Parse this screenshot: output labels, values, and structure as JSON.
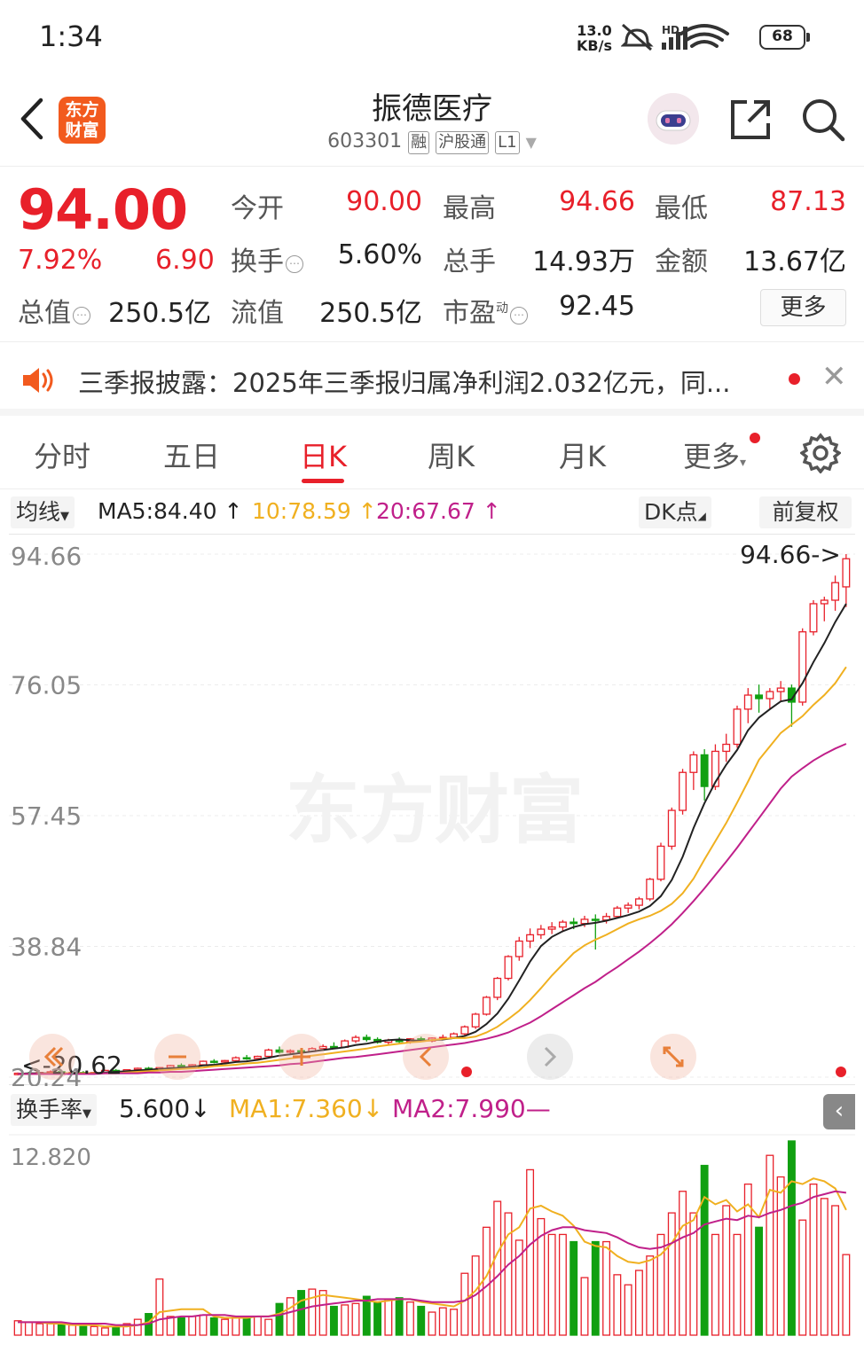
{
  "status_bar": {
    "time": "1:34",
    "net_speed_value": "13.0",
    "net_speed_unit": "KB/s",
    "network": "HD",
    "battery": "68",
    "icons": [
      "mute-icon",
      "signal-icon",
      "wifi-icon",
      "battery-icon"
    ]
  },
  "header": {
    "logo_line1": "东方",
    "logo_line2": "财富",
    "title": "振德医疗",
    "code": "603301",
    "tags": [
      "融",
      "沪股通",
      "L1"
    ]
  },
  "quote": {
    "price": "94.00",
    "change_pct": "7.92%",
    "change": "6.90",
    "fields": {
      "open_label": "今开",
      "open": "90.00",
      "high_label": "最高",
      "high": "94.66",
      "low_label": "最低",
      "low": "87.13",
      "turnover_label": "换手",
      "turnover": "5.60%",
      "volume_label": "总手",
      "volume": "14.93万",
      "amount_label": "金额",
      "amount": "13.67亿",
      "mktcap_label": "总值",
      "mktcap": "250.5亿",
      "float_label": "流值",
      "float_cap": "250.5亿",
      "pe_label": "市盈",
      "pe_sup": "动",
      "pe": "92.45"
    },
    "more_label": "更多"
  },
  "news": {
    "text": "三季报披露：2025年三季报归属净利润2.032亿元，同..."
  },
  "tabs": [
    {
      "label": "分时"
    },
    {
      "label": "五日"
    },
    {
      "label": "日K",
      "active": true
    },
    {
      "label": "周K"
    },
    {
      "label": "月K"
    },
    {
      "label": "更多"
    }
  ],
  "ma_bar": {
    "selector": "均线",
    "ma5": "MA5:84.40",
    "ma10": "10:78.59",
    "ma20": "20:67.67",
    "dk_label": "DK点",
    "adjust_label": "前复权"
  },
  "kline": {
    "y_labels": [
      "94.66",
      "76.05",
      "57.45",
      "38.84",
      "20.24"
    ],
    "high_note": "94.66->",
    "low_note": "<-20.62",
    "watermark": "东方财富",
    "colors": {
      "up": "#e8202a",
      "down": "#11a011",
      "ma5": "#222222",
      "ma10": "#f0b020",
      "ma20": "#c0208a"
    }
  },
  "volume": {
    "selector": "换手率",
    "value": "5.600",
    "ma1": "MA1:7.360",
    "ma2": "MA2:7.990—",
    "y_label": "12.820"
  },
  "chart_data": {
    "type": "candlestick",
    "ylim": [
      20.24,
      94.66
    ],
    "candles": [
      [
        20.6,
        20.9,
        20.5,
        20.8
      ],
      [
        20.8,
        21.0,
        20.6,
        20.7
      ],
      [
        20.7,
        20.9,
        20.5,
        20.9
      ],
      [
        20.9,
        21.2,
        20.8,
        21.0
      ],
      [
        21.0,
        21.1,
        20.7,
        20.8
      ],
      [
        20.8,
        21.0,
        20.6,
        20.9
      ],
      [
        20.9,
        21.1,
        20.7,
        20.8
      ],
      [
        20.8,
        21.0,
        20.62,
        20.9
      ],
      [
        20.9,
        21.3,
        20.8,
        21.2
      ],
      [
        21.2,
        21.4,
        21.0,
        21.1
      ],
      [
        21.1,
        21.3,
        20.9,
        21.3
      ],
      [
        21.3,
        21.6,
        21.2,
        21.5
      ],
      [
        21.5,
        21.7,
        21.3,
        21.4
      ],
      [
        21.4,
        21.6,
        21.2,
        21.6
      ],
      [
        21.6,
        22.0,
        21.5,
        21.9
      ],
      [
        21.9,
        22.2,
        21.7,
        21.8
      ],
      [
        21.8,
        22.1,
        21.6,
        22.0
      ],
      [
        22.0,
        22.6,
        21.9,
        22.5
      ],
      [
        22.5,
        22.8,
        22.2,
        22.4
      ],
      [
        22.4,
        22.7,
        22.1,
        22.6
      ],
      [
        22.6,
        23.2,
        22.5,
        23.0
      ],
      [
        23.0,
        23.4,
        22.7,
        22.9
      ],
      [
        22.9,
        23.3,
        22.6,
        23.2
      ],
      [
        23.2,
        24.3,
        23.1,
        24.1
      ],
      [
        24.1,
        24.6,
        23.6,
        23.8
      ],
      [
        23.8,
        24.2,
        23.4,
        24.0
      ],
      [
        24.0,
        24.4,
        23.7,
        23.9
      ],
      [
        23.9,
        24.5,
        23.8,
        24.3
      ],
      [
        24.3,
        24.9,
        24.1,
        24.6
      ],
      [
        24.6,
        25.2,
        24.3,
        24.5
      ],
      [
        24.5,
        25.6,
        24.4,
        25.4
      ],
      [
        25.4,
        26.2,
        25.1,
        25.9
      ],
      [
        25.9,
        26.3,
        25.3,
        25.6
      ],
      [
        25.6,
        25.9,
        25.0,
        25.2
      ],
      [
        25.2,
        25.7,
        24.9,
        25.5
      ],
      [
        25.5,
        25.9,
        25.1,
        25.3
      ],
      [
        25.3,
        25.8,
        25.0,
        25.7
      ],
      [
        25.7,
        26.0,
        25.3,
        25.4
      ],
      [
        25.4,
        25.9,
        25.2,
        25.8
      ],
      [
        25.8,
        26.3,
        25.5,
        25.9
      ],
      [
        25.9,
        26.6,
        25.7,
        26.4
      ],
      [
        26.4,
        27.6,
        26.2,
        27.4
      ],
      [
        27.4,
        29.4,
        27.1,
        29.2
      ],
      [
        29.2,
        31.8,
        29.0,
        31.6
      ],
      [
        31.6,
        34.5,
        31.2,
        34.3
      ],
      [
        34.3,
        37.6,
        34.0,
        37.4
      ],
      [
        37.4,
        40.2,
        36.8,
        39.6
      ],
      [
        39.6,
        41.4,
        38.6,
        40.5
      ],
      [
        40.5,
        41.9,
        39.9,
        41.3
      ],
      [
        41.3,
        42.3,
        40.6,
        41.6
      ],
      [
        41.6,
        42.6,
        40.9,
        42.3
      ],
      [
        42.3,
        42.9,
        41.3,
        42.1
      ],
      [
        42.1,
        43.2,
        41.6,
        42.7
      ],
      [
        42.7,
        43.4,
        38.4,
        42.6
      ],
      [
        42.6,
        43.6,
        42.1,
        43.1
      ],
      [
        43.1,
        44.6,
        42.9,
        44.3
      ],
      [
        44.3,
        45.1,
        43.6,
        44.7
      ],
      [
        44.7,
        45.9,
        44.1,
        45.6
      ],
      [
        45.6,
        48.6,
        45.3,
        48.4
      ],
      [
        48.4,
        53.6,
        48.1,
        53.1
      ],
      [
        53.1,
        58.6,
        52.6,
        58.2
      ],
      [
        58.2,
        64.1,
        57.6,
        63.6
      ],
      [
        63.6,
        66.6,
        61.1,
        66.1
      ],
      [
        66.1,
        66.9,
        59.6,
        61.6
      ],
      [
        61.6,
        67.6,
        61.1,
        66.6
      ],
      [
        66.6,
        69.1,
        65.1,
        67.6
      ],
      [
        67.6,
        73.1,
        67.1,
        72.6
      ],
      [
        72.6,
        75.6,
        70.6,
        74.6
      ],
      [
        74.6,
        76.1,
        72.1,
        74.1
      ],
      [
        74.1,
        75.6,
        72.6,
        75.1
      ],
      [
        75.1,
        76.6,
        73.6,
        75.6
      ],
      [
        75.6,
        76.1,
        70.1,
        73.6
      ],
      [
        73.6,
        84.1,
        73.1,
        83.6
      ],
      [
        83.6,
        88.1,
        83.1,
        87.6
      ],
      [
        87.6,
        88.6,
        85.1,
        88.1
      ],
      [
        88.1,
        91.6,
        86.6,
        90.6
      ],
      [
        90.0,
        94.66,
        87.13,
        94.0
      ]
    ],
    "ma5": [
      20.7,
      20.8,
      20.8,
      20.8,
      20.8,
      20.8,
      20.8,
      20.8,
      20.9,
      21.0,
      21.1,
      21.2,
      21.3,
      21.4,
      21.5,
      21.6,
      21.7,
      21.9,
      22.0,
      22.2,
      22.4,
      22.5,
      22.7,
      23.0,
      23.3,
      23.5,
      23.7,
      23.9,
      24.1,
      24.3,
      24.5,
      24.8,
      25.0,
      25.3,
      25.5,
      25.6,
      25.5,
      25.4,
      25.5,
      25.6,
      25.8,
      26.1,
      26.7,
      27.8,
      29.3,
      31.4,
      34.0,
      36.7,
      38.9,
      40.2,
      41.0,
      41.6,
      42.0,
      42.2,
      42.5,
      42.9,
      43.3,
      43.8,
      44.6,
      46.0,
      48.3,
      51.6,
      55.7,
      59.2,
      62.2,
      64.7,
      66.8,
      69.6,
      71.4,
      72.6,
      73.7,
      74.0,
      76.3,
      79.3,
      82.0,
      85.0,
      87.6
    ],
    "ma10": [
      20.7,
      20.7,
      20.7,
      20.8,
      20.8,
      20.8,
      20.8,
      20.8,
      20.8,
      20.8,
      20.9,
      21.0,
      21.1,
      21.2,
      21.3,
      21.4,
      21.5,
      21.6,
      21.8,
      21.9,
      22.0,
      22.2,
      22.3,
      22.5,
      22.7,
      22.9,
      23.1,
      23.3,
      23.5,
      23.7,
      23.9,
      24.1,
      24.3,
      24.6,
      24.8,
      25.0,
      25.2,
      25.3,
      25.5,
      25.7,
      25.8,
      25.8,
      26.0,
      26.6,
      27.4,
      28.5,
      29.7,
      31.2,
      32.9,
      34.7,
      36.3,
      37.9,
      39.0,
      39.8,
      40.5,
      41.3,
      42.1,
      42.7,
      43.2,
      43.9,
      44.9,
      46.4,
      48.5,
      51.2,
      53.8,
      56.4,
      59.3,
      62.3,
      65.4,
      67.3,
      69.2,
      70.4,
      71.6,
      73.2,
      74.6,
      76.3,
      78.6
    ],
    "ma20": [
      20.7,
      20.7,
      20.7,
      20.7,
      20.7,
      20.7,
      20.7,
      20.7,
      20.8,
      20.8,
      20.8,
      20.8,
      20.9,
      20.9,
      21.0,
      21.0,
      21.1,
      21.2,
      21.3,
      21.4,
      21.5,
      21.6,
      21.7,
      21.8,
      21.9,
      22.1,
      22.2,
      22.4,
      22.6,
      22.8,
      23.0,
      23.1,
      23.3,
      23.5,
      23.7,
      23.9,
      24.1,
      24.3,
      24.5,
      24.7,
      24.9,
      25.1,
      25.4,
      25.7,
      26.1,
      26.6,
      27.3,
      28.0,
      28.9,
      29.9,
      30.9,
      31.9,
      32.9,
      33.8,
      34.9,
      35.9,
      37.0,
      38.1,
      39.3,
      40.6,
      42.0,
      43.6,
      45.3,
      47.1,
      49.0,
      50.9,
      52.9,
      55.0,
      57.1,
      59.2,
      61.3,
      63.0,
      64.2,
      65.3,
      66.2,
      67.0,
      67.67
    ],
    "turnover": [
      1.0,
      0.9,
      0.8,
      0.8,
      0.7,
      0.7,
      0.6,
      0.6,
      0.5,
      0.6,
      0.8,
      1.1,
      1.5,
      3.9,
      1.3,
      1.2,
      1.3,
      1.4,
      1.2,
      1.1,
      1.3,
      1.2,
      1.3,
      1.1,
      2.2,
      2.6,
      3.1,
      3.2,
      3.1,
      2.0,
      2.1,
      2.2,
      2.7,
      2.3,
      2.5,
      2.6,
      2.3,
      2.0,
      1.6,
      1.9,
      1.8,
      4.3,
      5.5,
      7.5,
      9.3,
      8.5,
      6.6,
      11.5,
      8.1,
      7.0,
      7.0,
      6.5,
      4.0,
      6.5,
      6.5,
      4.2,
      3.5,
      4.5,
      5.5,
      7.0,
      8.5,
      10.0,
      8.5,
      11.8,
      7.0,
      9.0,
      7.0,
      10.5,
      7.5,
      12.5,
      11.0,
      13.5,
      8.0,
      10.5,
      9.5,
      9.0,
      5.6
    ],
    "turnover_up": [
      true,
      true,
      true,
      true,
      false,
      true,
      false,
      true,
      true,
      false,
      true,
      true,
      false,
      true,
      true,
      false,
      true,
      true,
      false,
      true,
      true,
      false,
      true,
      true,
      false,
      true,
      false,
      true,
      true,
      false,
      true,
      true,
      false,
      false,
      true,
      false,
      true,
      false,
      true,
      true,
      true,
      true,
      true,
      true,
      true,
      true,
      true,
      true,
      true,
      true,
      true,
      false,
      true,
      false,
      true,
      true,
      true,
      true,
      true,
      true,
      true,
      true,
      true,
      false,
      true,
      true,
      true,
      true,
      false,
      true,
      true,
      false,
      true,
      true,
      true,
      true,
      true
    ],
    "turnover_ma1": [
      0.9,
      0.9,
      0.9,
      0.8,
      0.8,
      0.7,
      0.7,
      0.7,
      0.6,
      0.6,
      0.6,
      0.7,
      0.9,
      1.6,
      1.7,
      1.8,
      1.8,
      1.8,
      1.3,
      1.2,
      1.2,
      1.2,
      1.3,
      1.3,
      1.5,
      1.9,
      2.4,
      2.6,
      2.8,
      2.7,
      2.6,
      2.5,
      2.4,
      2.3,
      2.4,
      2.5,
      2.5,
      2.3,
      2.2,
      2.1,
      2.0,
      2.4,
      3.1,
      4.1,
      5.7,
      7.0,
      7.5,
      8.8,
      9.0,
      8.6,
      8.3,
      7.6,
      6.5,
      6.2,
      6.1,
      5.5,
      5.1,
      5.0,
      5.2,
      5.6,
      6.4,
      7.6,
      8.0,
      9.6,
      9.1,
      9.4,
      8.6,
      9.1,
      8.2,
      10.1,
      9.9,
      10.7,
      10.5,
      10.9,
      10.7,
      10.2,
      8.7
    ],
    "turnover_ma2": [
      0.9,
      0.9,
      0.9,
      0.9,
      0.9,
      0.8,
      0.8,
      0.8,
      0.8,
      0.7,
      0.7,
      0.7,
      0.8,
      1.1,
      1.2,
      1.3,
      1.3,
      1.4,
      1.4,
      1.4,
      1.3,
      1.3,
      1.3,
      1.3,
      1.4,
      1.6,
      1.8,
      2.0,
      2.1,
      2.2,
      2.3,
      2.4,
      2.4,
      2.5,
      2.5,
      2.5,
      2.5,
      2.4,
      2.3,
      2.3,
      2.3,
      2.4,
      2.8,
      3.4,
      4.1,
      4.9,
      5.5,
      6.3,
      6.9,
      7.3,
      7.5,
      7.5,
      7.3,
      7.2,
      7.1,
      6.8,
      6.4,
      6.1,
      6.0,
      6.1,
      6.4,
      6.8,
      7.1,
      7.7,
      7.9,
      8.1,
      8.0,
      8.3,
      8.2,
      8.5,
      8.7,
      9.0,
      9.2,
      9.6,
      9.8,
      10.0,
      9.9
    ],
    "turnover_ylim": [
      0,
      12.82
    ]
  }
}
